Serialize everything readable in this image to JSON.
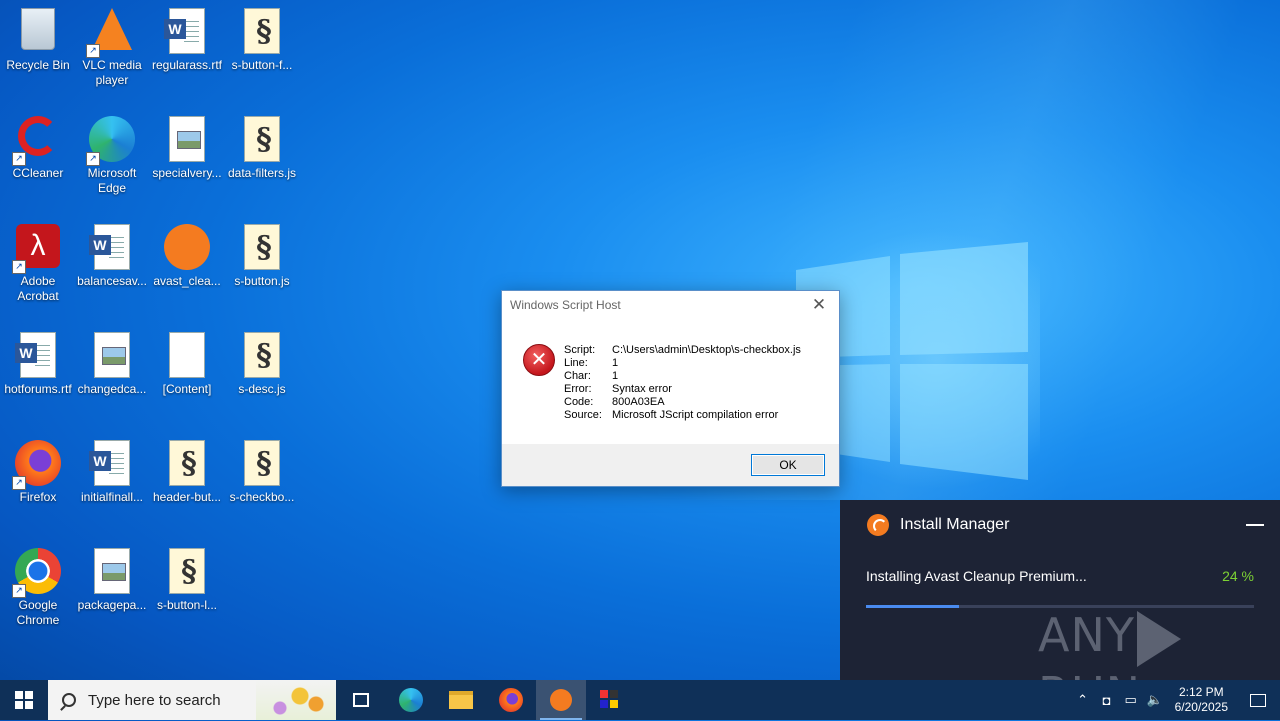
{
  "desktop": {
    "icons": [
      {
        "label": "Recycle Bin",
        "kind": "recycle-bin-icon"
      },
      {
        "label": "VLC media player",
        "kind": "vlc-icon"
      },
      {
        "label": "regularass.rtf",
        "kind": "word-document-icon"
      },
      {
        "label": "s-button-f...",
        "kind": "script-file-icon"
      },
      {
        "label": "CCleaner",
        "kind": "ccleaner-icon"
      },
      {
        "label": "Microsoft Edge",
        "kind": "edge-icon"
      },
      {
        "label": "specialvery...",
        "kind": "image-file-icon"
      },
      {
        "label": "data-filters.js",
        "kind": "script-file-icon"
      },
      {
        "label": "Adobe Acrobat",
        "kind": "acrobat-icon"
      },
      {
        "label": "balancesav...",
        "kind": "word-document-icon"
      },
      {
        "label": "avast_clea...",
        "kind": "avast-icon"
      },
      {
        "label": "s-button.js",
        "kind": "script-file-icon"
      },
      {
        "label": "hotforums.rtf",
        "kind": "word-document-icon"
      },
      {
        "label": "changedca...",
        "kind": "image-file-icon"
      },
      {
        "label": "[Content]",
        "kind": "blank-file-icon"
      },
      {
        "label": "s-desc.js",
        "kind": "script-file-icon"
      },
      {
        "label": "Firefox",
        "kind": "firefox-icon"
      },
      {
        "label": "initialfinall...",
        "kind": "word-document-icon"
      },
      {
        "label": "header-but...",
        "kind": "script-file-icon"
      },
      {
        "label": "s-checkbo...",
        "kind": "script-file-icon"
      },
      {
        "label": "Google Chrome",
        "kind": "chrome-icon"
      },
      {
        "label": "packagepa...",
        "kind": "image-file-icon"
      },
      {
        "label": "s-button-l...",
        "kind": "script-file-icon"
      }
    ]
  },
  "dialog": {
    "title": "Windows Script Host",
    "close_glyph": "✕",
    "rows": [
      {
        "key": "Script:",
        "value": "C:\\Users\\admin\\Desktop\\s-checkbox.js"
      },
      {
        "key": "Line:",
        "value": "1"
      },
      {
        "key": "Char:",
        "value": "1"
      },
      {
        "key": "Error:",
        "value": "Syntax error"
      },
      {
        "key": "Code:",
        "value": "800A03EA"
      },
      {
        "key": "Source:",
        "value": "Microsoft JScript compilation error"
      }
    ],
    "ok_label": "OK"
  },
  "install_manager": {
    "title": "Install Manager",
    "status": "Installing Avast Cleanup Premium...",
    "percent_label": "24 %",
    "progress": 0.24,
    "watermark_left": "ANY",
    "watermark_right": "RUN"
  },
  "taskbar": {
    "search_placeholder": "Type here to search",
    "clock_time": "2:12 PM",
    "clock_date": "6/20/2025"
  },
  "colors": {
    "accent": "#0078d7",
    "progress_fill": "#4a8bf0",
    "percent_green": "#7dd134",
    "error_red": "#c4161c"
  }
}
